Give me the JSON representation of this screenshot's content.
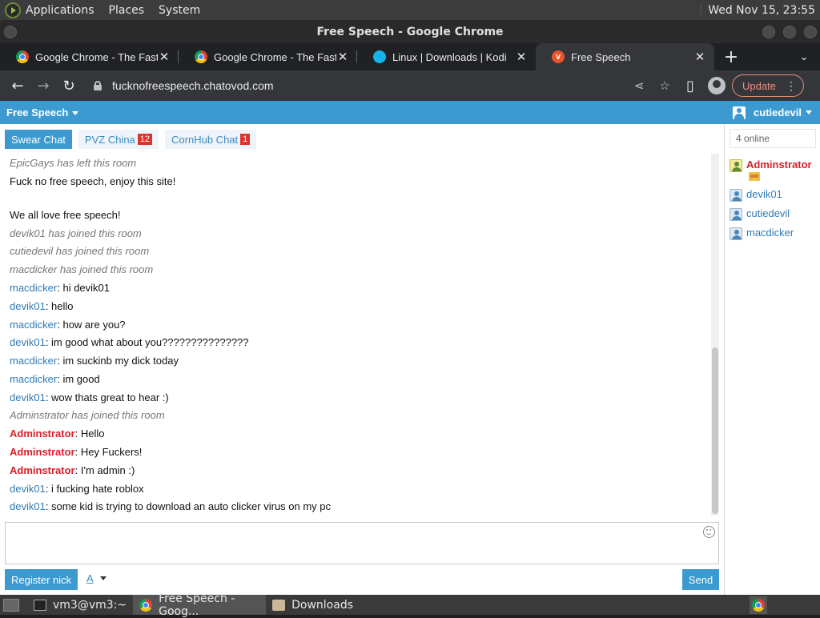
{
  "top_panel": {
    "menus": [
      "Applications",
      "Places",
      "System"
    ],
    "clock": "Wed Nov 15, 23:55"
  },
  "window": {
    "title": "Free Speech - Google Chrome"
  },
  "tabs": [
    {
      "title": "Google Chrome - The Fast & Secure",
      "icon": "chrome-icon"
    },
    {
      "title": "Google Chrome - The Fast & Secure",
      "icon": "chrome-icon"
    },
    {
      "title": "Linux | Downloads | Kodi",
      "icon": "kodi-icon"
    },
    {
      "title": "Free Speech",
      "icon": "site-icon",
      "active": true
    }
  ],
  "toolbar": {
    "url": "fucknofreespeech.chatovod.com",
    "update_label": "Update"
  },
  "site": {
    "brand": "Free Speech",
    "username": "cutiedevil",
    "accent": "#3c9ad1"
  },
  "rooms": [
    {
      "label": "Swear Chat",
      "badge": "",
      "active": true
    },
    {
      "label": "PVZ China",
      "badge": "12"
    },
    {
      "label": "CornHub Chat",
      "badge": "1"
    }
  ],
  "messages": [
    {
      "type": "system",
      "text": "EpicGays has left this room"
    },
    {
      "type": "text",
      "text": "Fuck no free speech, enjoy this site!"
    },
    {
      "type": "text",
      "text": "We all love free speech!"
    },
    {
      "type": "system",
      "text": "devik01 has joined this room"
    },
    {
      "type": "system",
      "text": "cutiedevil has joined this room"
    },
    {
      "type": "system",
      "text": "macdicker has joined this room"
    },
    {
      "type": "chat",
      "nick": "macdicker",
      "text": ": hi devik01"
    },
    {
      "type": "chat",
      "nick": "devik01",
      "text": ": hello"
    },
    {
      "type": "chat",
      "nick": "macdicker",
      "text": ": how are you?"
    },
    {
      "type": "chat",
      "nick": "devik01",
      "text": ": im good what about you???????????????"
    },
    {
      "type": "chat",
      "nick": "macdicker",
      "text": ": im suckinb my dick today"
    },
    {
      "type": "chat",
      "nick": "macdicker",
      "text": ": im good"
    },
    {
      "type": "chat",
      "nick": "devik01",
      "text": ": wow thats great to hear :)"
    },
    {
      "type": "system",
      "text": "Adminstrator has joined this room"
    },
    {
      "type": "chat",
      "nick": "Adminstrator",
      "admin": true,
      "text": ": Hello"
    },
    {
      "type": "chat",
      "nick": "Adminstrator",
      "admin": true,
      "text": ": Hey Fuckers!"
    },
    {
      "type": "chat",
      "nick": "Adminstrator",
      "admin": true,
      "text": ": I'm admin :)"
    },
    {
      "type": "chat",
      "nick": "devik01",
      "text": ": i fucking hate roblox"
    },
    {
      "type": "chat",
      "nick": "devik01",
      "text": ": some kid is trying to download an auto clicker virus on my pc"
    }
  ],
  "composer": {
    "register_label": "Register nick",
    "font_letter": "A",
    "send_label": "Send"
  },
  "sidebar": {
    "online": "4 online",
    "users": [
      {
        "name": "Adminstrator",
        "admin": true
      },
      {
        "name": "devik01"
      },
      {
        "name": "cutiedevil"
      },
      {
        "name": "macdicker"
      }
    ]
  },
  "taskbar": {
    "items": [
      {
        "label": "vm3@vm3:~",
        "icon": "terminal-icon"
      },
      {
        "label": "Free Speech - Goog...",
        "icon": "chrome-icon",
        "active": true
      },
      {
        "label": "Downloads",
        "icon": "folder-icon"
      }
    ]
  }
}
